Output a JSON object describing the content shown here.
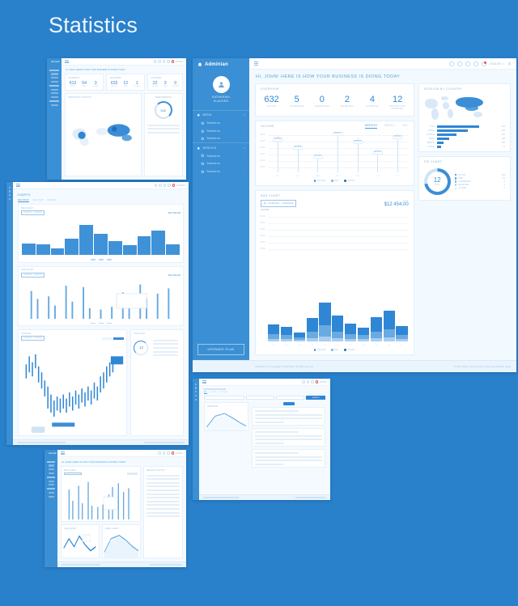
{
  "page": {
    "title": "Statistics",
    "background_color": "#2980cb"
  },
  "main_window": {
    "sidebar": {
      "brand": "Adminian",
      "brand_icon": "bell-icon",
      "profile": {
        "avatar_initial": "A",
        "name_line1": "KATHARINA",
        "name_line2": "KLAUSEN"
      },
      "groups": [
        {
          "label": "MENU",
          "icon": "star-icon",
          "items": [
            {
              "label": "Submenu",
              "icon": "gear-icon"
            },
            {
              "label": "Submenu",
              "icon": "gear-icon"
            },
            {
              "label": "Submenu",
              "icon": "gear-icon"
            }
          ]
        },
        {
          "label": "SERVICE",
          "icon": "star-icon",
          "items": [
            {
              "label": "Submenu",
              "icon": "gear-icon"
            },
            {
              "label": "Submenu",
              "icon": "gear-icon"
            },
            {
              "label": "Submenu",
              "icon": "gear-icon"
            }
          ]
        }
      ],
      "upgrade_button": "UPGRADE PLAN"
    },
    "topbar": {
      "menu_toggle": "hamburger-icon",
      "icons": [
        "search-icon",
        "gear-icon",
        "activity-icon",
        "camera-icon",
        "bell-icon"
      ],
      "notification_badge": "3",
      "language_selector": "ENGLISH",
      "user_menu": "user-icon"
    },
    "greeting": "HI, JOHN! HERE IS HOW YOUR BUSINESS IS DOING TODAY",
    "overview": {
      "title": "OVERVIEW",
      "stats": [
        {
          "value": "632",
          "label": "ACTIVE"
        },
        {
          "value": "5",
          "label": "SUSPENDED"
        },
        {
          "value": "0",
          "label": "GRADUATED"
        },
        {
          "value": "2",
          "label": "REJECTED"
        },
        {
          "value": "4",
          "label": "ACCEPTED"
        },
        {
          "value": "12",
          "label": "WAITING FOR APPROVAL"
        }
      ]
    },
    "income": {
      "title": "INCOME",
      "tabs": [
        {
          "label": "MONTHLY",
          "active": true
        },
        {
          "label": "WEEKLY",
          "active": false
        },
        {
          "label": "DAY",
          "active": false
        }
      ],
      "legend": [
        "INCOME",
        "NET",
        "PROFIT"
      ]
    },
    "bar_chart": {
      "title": "BAR CHART",
      "date_range": "01/08/2019 — 01/09/2019",
      "date_icon": "calendar-icon",
      "total_caption": "TOTAL",
      "total_value": "$12 454.00",
      "sub_caption": "INCOME",
      "legend": [
        "INCOME",
        "NET",
        "PROFIT"
      ]
    },
    "session_by_country": {
      "title": "SESSION BY COUNTRY",
      "rows": [
        {
          "country": "USA",
          "value": "842"
        },
        {
          "country": "CHINA",
          "value": "613"
        },
        {
          "country": "RUSSIA",
          "value": "391"
        },
        {
          "country": "INDIA",
          "value": "245"
        },
        {
          "country": "BRAZIL",
          "value": "128"
        },
        {
          "country": "JAPAN",
          "value": "74"
        }
      ]
    },
    "pie_chart": {
      "title": "PIE CHART",
      "center_value": "12",
      "center_label": "TOTAL",
      "legend": [
        {
          "label": "ACTIVE",
          "value": "632"
        },
        {
          "label": "NEW",
          "value": "12"
        },
        {
          "label": "SUSPENDED",
          "value": "5"
        },
        {
          "label": "REJECTED",
          "value": "2"
        },
        {
          "label": "CLOSED",
          "value": "0"
        }
      ]
    },
    "footer": {
      "copyright": "Adminian v1.1  |  Copyright © 2019 Kapi. All rights reserved.",
      "links": [
        "Privacy Policy",
        "Terms of Use",
        "Sales and Refunds",
        "Help"
      ]
    }
  },
  "chart_data": [
    {
      "id": "income-needle-chart",
      "type": "bar",
      "title": "INCOME",
      "categories": [
        "JAN",
        "FEB",
        "MAR",
        "APR",
        "MAY",
        "JUN",
        "JUL"
      ],
      "values": [
        42000,
        28000,
        14000,
        66000,
        38000,
        22000,
        54000
      ],
      "labels": [
        "$42,000",
        "$28,000",
        "$14,000",
        "$66,000",
        "$38,000",
        "$22,000",
        "$54,000"
      ],
      "ylabel": "",
      "xlabel": "",
      "ylim": [
        0,
        80000
      ],
      "grid": true,
      "legend": [
        "INCOME",
        "NET",
        "PROFIT"
      ],
      "legend_position": "bottom"
    },
    {
      "id": "main-bar-chart",
      "type": "bar",
      "title": "BAR CHART",
      "stacked": true,
      "categories": [
        "01",
        "02",
        "03",
        "04",
        "05",
        "06",
        "07",
        "08",
        "09",
        "10",
        "11",
        "12"
      ],
      "series": [
        {
          "name": "INCOME",
          "values": [
            18,
            15,
            9,
            26,
            48,
            33,
            21,
            14,
            29,
            38,
            17,
            0
          ]
        },
        {
          "name": "NET",
          "values": [
            9,
            8,
            5,
            12,
            22,
            12,
            10,
            8,
            13,
            15,
            9,
            0
          ]
        },
        {
          "name": "PROFIT",
          "values": [
            4,
            3,
            2,
            6,
            10,
            5,
            4,
            3,
            6,
            7,
            4,
            0
          ]
        }
      ],
      "ylim": [
        0,
        60
      ],
      "grid": true,
      "legend_position": "bottom"
    },
    {
      "id": "session-by-country",
      "type": "bar",
      "orientation": "horizontal",
      "title": "SESSION BY COUNTRY",
      "categories": [
        "USA",
        "CHINA",
        "RUSSIA",
        "INDIA",
        "BRAZIL",
        "JAPAN"
      ],
      "values": [
        842,
        613,
        391,
        245,
        128,
        74
      ],
      "ylim": [
        0,
        900
      ]
    },
    {
      "id": "pie-chart",
      "type": "pie",
      "title": "PIE CHART",
      "labels": [
        "ACTIVE",
        "NEW",
        "SUSPENDED",
        "REJECTED",
        "CLOSED"
      ],
      "values": [
        632,
        12,
        5,
        2,
        0
      ],
      "center_text": "12"
    }
  ],
  "thumbnails": {
    "top_left": {
      "name": "dashboard-overview-thumbnail",
      "brand": "Adminian",
      "title": "HI, JOHN! HERE IS HOW YOUR BUSINESS IS DOING TODAY",
      "cards": [
        {
          "title": "STUDENTS",
          "stats": [
            {
              "value": "612",
              "label": "ACTIVE"
            },
            {
              "value": "54",
              "label": "NEW"
            },
            {
              "value": "3",
              "label": "CLOSED"
            }
          ]
        },
        {
          "title": "TEACHERS",
          "stats": [
            {
              "value": "632",
              "label": "ACTIVE"
            },
            {
              "value": "12",
              "label": "NEW"
            },
            {
              "value": "1",
              "label": "CLOSED"
            }
          ]
        },
        {
          "title": "COURSES",
          "stats": [
            {
              "value": "22",
              "label": "ACTIVE"
            },
            {
              "value": "3",
              "label": "NEW"
            },
            {
              "value": "0",
              "label": "CLOSED"
            }
          ]
        }
      ],
      "map_card": "SESSION BY COUNTRY",
      "gauge_card": "PERFORMANCE",
      "gauge_value": "642"
    },
    "left_large": {
      "name": "charts-page-thumbnail",
      "title": "CHARTS",
      "tabs": [
        "BAR CHART",
        "LINE CHART",
        "CANDLES"
      ],
      "sections": [
        {
          "title": "BAR CHART",
          "total": "$12 454.00",
          "range": "01/08/2019 — 01/09/2019"
        },
        {
          "title": "LINE CHART",
          "total": "$12 454.00",
          "range": "01/08/2019 — 01/09/2019"
        },
        {
          "title": "CANDLES",
          "range": "01/08/2019 — 01/09/2019"
        },
        {
          "title": "PIE CHART",
          "center_value": "12"
        }
      ],
      "footer": "Adminian v1.1  |  Copyright © 2019 Kapi. All rights reserved."
    },
    "bottom_center": {
      "name": "analytics-page-thumbnail",
      "brand": "Adminian",
      "title": "HI, JOHN! HERE IS HOW YOUR BUSINESS IS DOING TODAY",
      "cards": [
        "BAR CHART",
        "LINE CHART",
        "AREA CHART"
      ],
      "side_panel": "RECENT ACTIVITY"
    },
    "bottom_right": {
      "name": "search-list-page-thumbnail",
      "tabs": [
        "ALL",
        "ACTIVE",
        "CLOSED"
      ],
      "search_button": "SEARCH",
      "chart_card": "SESSIONS",
      "list_groups": 3
    }
  }
}
